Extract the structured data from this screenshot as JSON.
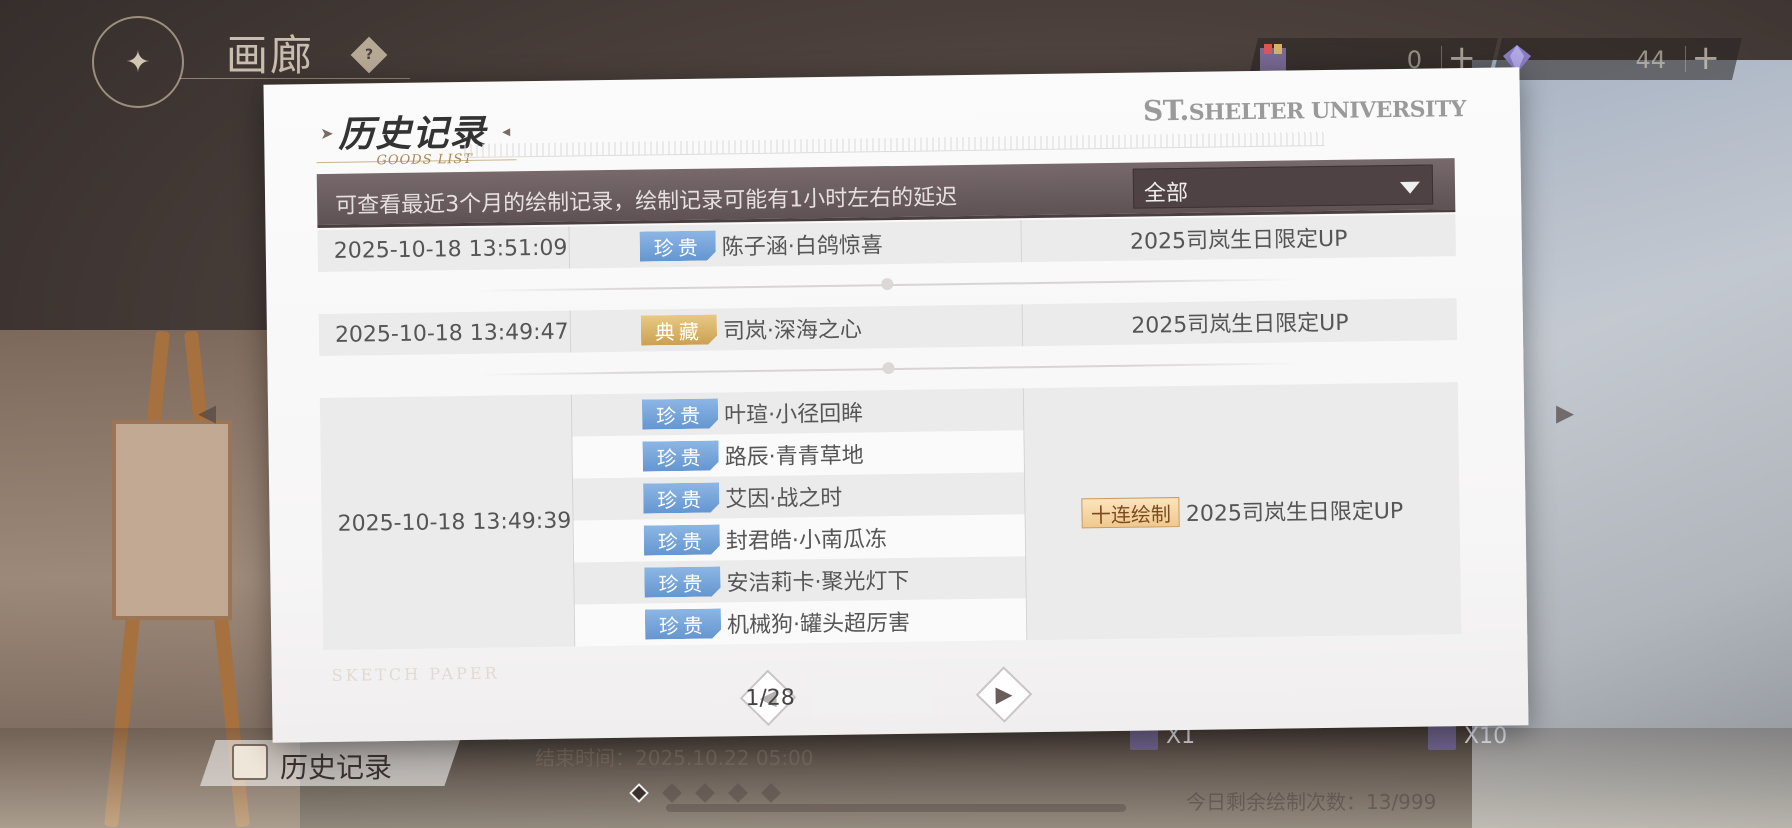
{
  "header": {
    "gallery_title": "画廊",
    "help_label": "?",
    "currency_1_value": "0",
    "currency_2_value": "44",
    "plus_label": "+"
  },
  "modal": {
    "title": "历史记录",
    "subtitle": "GOODS LIST",
    "brand_prefix": "ST.",
    "brand_name": "SHELTER UNIVERSITY",
    "filter_note": "可查看最近3个月的绘制记录，绘制记录可能有1小时左右的延迟",
    "filter_value": "全部",
    "footer_mark": "SKETCH PAPER",
    "records": [
      {
        "time": "2025-10-18  13:51:09",
        "pool": "2025司岚生日限定UP",
        "items": [
          {
            "rarity": "珍贵",
            "name": "陈子涵·白鸽惊喜"
          }
        ]
      },
      {
        "time": "2025-10-18  13:49:47",
        "pool": "2025司岚生日限定UP",
        "items": [
          {
            "rarity": "典藏",
            "name": "司岚·深海之心"
          }
        ]
      },
      {
        "time": "2025-10-18  13:49:39",
        "pool": "2025司岚生日限定UP",
        "badge": "十连绘制",
        "items": [
          {
            "rarity": "珍贵",
            "name": "叶瑄·小径回眸"
          },
          {
            "rarity": "珍贵",
            "name": "路辰·青青草地"
          },
          {
            "rarity": "珍贵",
            "name": "艾因·战之时"
          },
          {
            "rarity": "珍贵",
            "name": "封君皓·小南瓜冻"
          },
          {
            "rarity": "珍贵",
            "name": "安洁莉卡·聚光灯下"
          },
          {
            "rarity": "珍贵",
            "name": "机械狗·罐头超厉害"
          }
        ]
      }
    ],
    "pagination": {
      "text": "1/28"
    }
  },
  "scene": {
    "history_button": "历史记录",
    "end_time": "结束时间：2025.10.22  05:00",
    "draw_x1": "X1",
    "draw_x10": "X10",
    "remaining": "今日剩余绘制次数：13/999"
  },
  "colors": {
    "rarity_precious": "#7aa6dc",
    "rarity_collect": "#d9b466",
    "filter_bar": "#6b5e60"
  }
}
